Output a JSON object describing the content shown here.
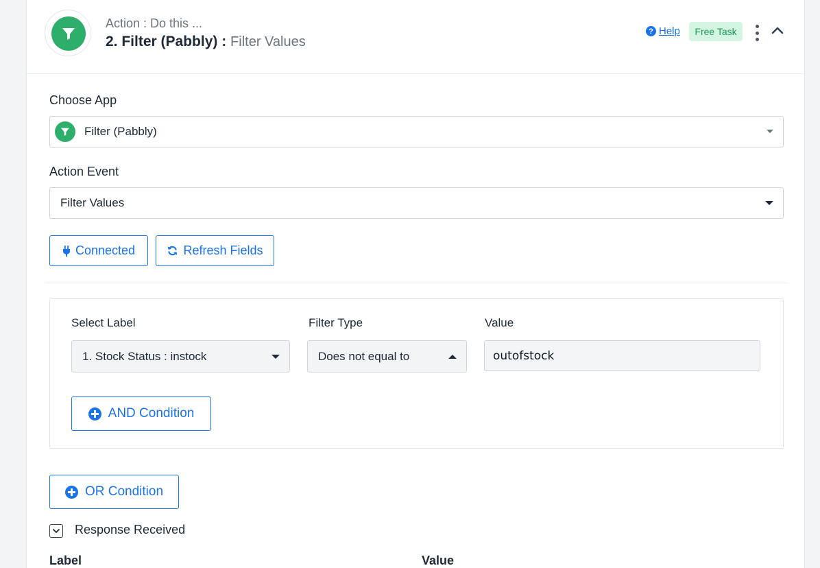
{
  "header": {
    "subtitle": "Action : Do this ...",
    "title": "2. Filter (Pabbly) :",
    "event": "Filter Values",
    "help_label": "Help",
    "badge": "Free Task"
  },
  "choose_app": {
    "label": "Choose App",
    "value": "Filter (Pabbly)"
  },
  "action_event": {
    "label": "Action Event",
    "value": "Filter Values"
  },
  "buttons": {
    "connected": "Connected",
    "refresh": "Refresh Fields",
    "and_condition": "AND Condition",
    "or_condition": "OR Condition"
  },
  "condition": {
    "select_label_header": "Select Label",
    "filter_type_header": "Filter Type",
    "value_header": "Value",
    "select_label_value": "1. Stock Status : instock",
    "filter_type_value": "Does not equal to",
    "value": "outofstock"
  },
  "response": {
    "title": "Response Received",
    "col_label": "Label",
    "col_value": "Value"
  },
  "colors": {
    "accent": "#1a73e8",
    "brand_green": "#2eae6b",
    "badge_bg": "#d5f5e3",
    "badge_text": "#1d9a5b"
  },
  "icons": [
    "filter-icon",
    "help-circle-icon",
    "kebab-menu-icon",
    "chevron-up-icon",
    "plug-icon",
    "refresh-icon",
    "plus-circle-icon",
    "chevron-down-icon"
  ]
}
